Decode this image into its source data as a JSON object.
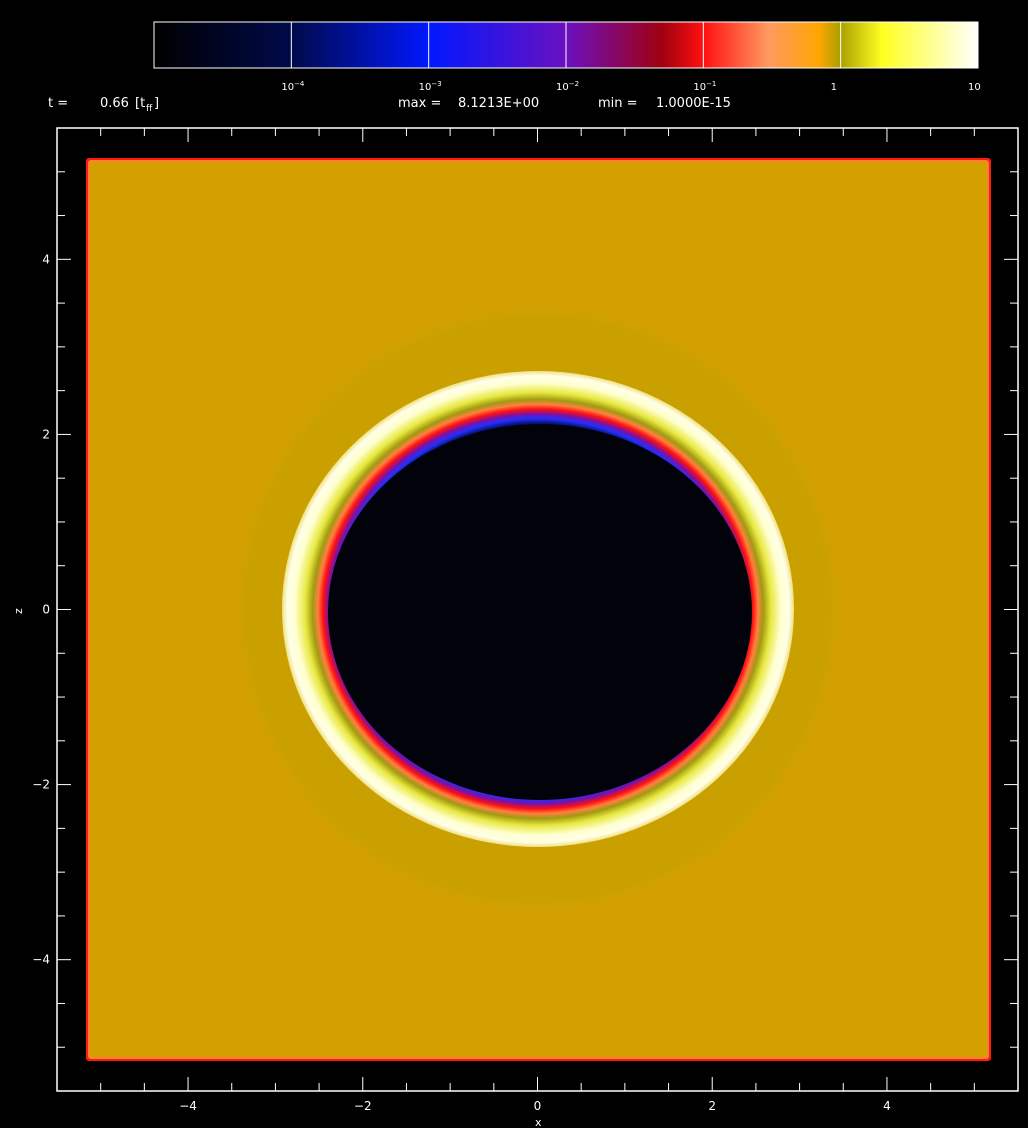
{
  "header": {
    "time_label": "t =",
    "time_value": "0.66",
    "time_unit_open": "[t",
    "time_unit_sub": "ff",
    "time_unit_close": "]",
    "max_label": "max =",
    "max_value": "8.1213E+00",
    "min_label": "min =",
    "min_value": "1.0000E-15"
  },
  "colorbar": {
    "scale": "log",
    "range": [
      1e-05,
      10
    ],
    "ticks": [
      {
        "value": 0.0001,
        "label": "10",
        "exp": "−4"
      },
      {
        "value": 0.001,
        "label": "10",
        "exp": "−3"
      },
      {
        "value": 0.01,
        "label": "10",
        "exp": "−2"
      },
      {
        "value": 0.1,
        "label": "10",
        "exp": "−1"
      },
      {
        "value": 1,
        "label": "1",
        "exp": ""
      },
      {
        "value": 10,
        "label": "10",
        "exp": ""
      }
    ],
    "colors": [
      {
        "value": 1e-05,
        "color": "#000000"
      },
      {
        "value": 0.0001,
        "color": "#000a4a"
      },
      {
        "value": 0.001,
        "color": "#0018ff"
      },
      {
        "value": 0.01,
        "color": "#6a10c0"
      },
      {
        "value": 0.05,
        "color": "#a00010"
      },
      {
        "value": 0.1,
        "color": "#ff1010"
      },
      {
        "value": 0.3,
        "color": "#ff9a60"
      },
      {
        "value": 0.7,
        "color": "#ffa500"
      },
      {
        "value": 1,
        "color": "#aaa000"
      },
      {
        "value": 2,
        "color": "#ffff20"
      },
      {
        "value": 10,
        "color": "#ffffff"
      }
    ]
  },
  "chart_data": {
    "type": "heatmap",
    "title": "",
    "xlabel": "x",
    "ylabel": "z",
    "xlim": [
      -5.5,
      5.5
    ],
    "ylim": [
      -5.5,
      5.5
    ],
    "xticks": [
      -4,
      -2,
      0,
      2,
      4
    ],
    "yticks": [
      -4,
      -2,
      0,
      2,
      4
    ],
    "xtick_labels": [
      "−4",
      "−2",
      "0",
      "2",
      "4"
    ],
    "ytick_labels": [
      "−4",
      "−2",
      "0",
      "2",
      "4"
    ],
    "time": 0.66,
    "max": 8.1213,
    "min": 1e-15,
    "regions": [
      {
        "name": "ambient box",
        "half_width": 5.1,
        "value": 0.6,
        "color": "#d4a000",
        "edge_color": "#ff2020"
      },
      {
        "name": "outer halo",
        "radius": 3.5,
        "value": 0.8,
        "color": "#ca9f00"
      },
      {
        "name": "shell",
        "radius": 2.9,
        "value": 5,
        "color": "#ffffe0"
      },
      {
        "name": "cavity",
        "radius": 2.4,
        "value": 1e-15,
        "color": "#02020a",
        "rim_color": "#2030ff"
      }
    ]
  }
}
